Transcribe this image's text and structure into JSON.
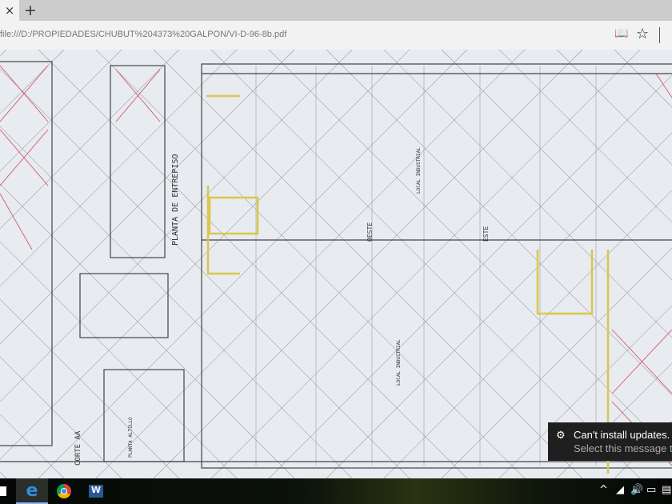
{
  "browser": {
    "tab_close": "×",
    "new_tab": "+",
    "url": "file:///D:/PROPIEDADES/CHUBUT%204373%20GALPON/VI-D-96-8b.pdf",
    "reading_view": "📖",
    "favorite": "☆"
  },
  "drawing": {
    "labels": {
      "plan": "PLANTA DE ENTREPISO",
      "section": "CORTE AA",
      "local1": "LOCAL INDUSTRIAL",
      "local2": "LOCAL INDUSTRIAL",
      "planta2": "PLANTA ALTILLO",
      "oeste": "OESTE",
      "este": "ESTE"
    }
  },
  "notification": {
    "title": "Can't install updates.",
    "body": "Select this message to"
  },
  "taskbar": {
    "apps": [
      "start",
      "edge",
      "chrome",
      "word"
    ]
  },
  "colors": {
    "accent_edge": "#1e73d2",
    "paper": "#e8ebf0",
    "line": "#4a4a4a",
    "highlight": "#d9c84a",
    "red": "#d24a5a"
  }
}
